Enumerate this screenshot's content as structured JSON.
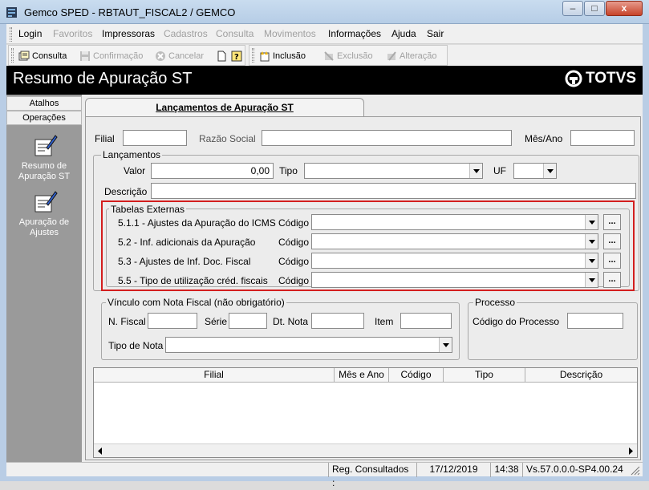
{
  "window": {
    "title": "Gemco SPED - RBTAUT_FISCAL2 / GEMCO",
    "minimize": "–",
    "maximize": "□",
    "close": "x"
  },
  "menu": [
    "Login",
    "Favoritos",
    "Impressoras",
    "Cadastros",
    "Consulta",
    "Movimentos",
    "Informações",
    "Ajuda",
    "Sair"
  ],
  "toolbar": {
    "consulta": "Consulta",
    "confirmacao": "Confirmação",
    "cancelar": "Cancelar",
    "inclusao": "Inclusão",
    "exclusao": "Exclusão",
    "alteracao": "Alteração"
  },
  "header": {
    "title": "Resumo de Apuração ST",
    "logo": "TOTVS"
  },
  "side": {
    "tab_atalhos": "Atalhos",
    "tab_operacoes": "Operações",
    "items": [
      "Resumo de Apuração ST",
      "Apuração de Ajustes"
    ]
  },
  "tab": {
    "label": "Lançamentos de Apuração ST"
  },
  "form": {
    "filial_label": "Filial",
    "razao_label": "Razão Social",
    "mesano_label": "Mês/Ano",
    "lancamentos_legend": "Lançamentos",
    "valor_label": "Valor",
    "valor_value": "0,00",
    "tipo_label": "Tipo",
    "uf_label": "UF",
    "descricao_label": "Descrição",
    "tabelas_legend": "Tabelas Externas",
    "tabelas": [
      {
        "label": "5.1.1 - Ajustes da Apuração do ICMS",
        "codigo": "Código"
      },
      {
        "label": "5.2 - Inf. adicionais da Apuração",
        "codigo": "Código"
      },
      {
        "label": "5.3 - Ajustes de Inf. Doc. Fiscal",
        "codigo": "Código"
      },
      {
        "label": "5.5 - Tipo de utilização créd. fiscais",
        "codigo": "Código"
      }
    ],
    "dots": "...",
    "vinculo_legend": "Vínculo com Nota Fiscal (não obrigatório)",
    "nfiscal_label": "N. Fiscal",
    "serie_label": "Série",
    "dtnota_label": "Dt. Nota",
    "item_label": "Item",
    "tiponota_label": "Tipo de Nota",
    "processo_legend": "Processo",
    "codprocesso_label": "Código do Processo"
  },
  "grid": {
    "columns": [
      "Filial",
      "Mês e Ano",
      "Código",
      "Tipo",
      "Descrição"
    ]
  },
  "status": {
    "reg": "Reg. Consultados :",
    "date": "17/12/2019",
    "time": "14:38",
    "version": "Vs.57.0.0.0-SP4.00.24"
  },
  "colors": {
    "header_bg": "#000000",
    "highlight_red": "#d31e1e",
    "side_bg": "#9a9a9a"
  }
}
